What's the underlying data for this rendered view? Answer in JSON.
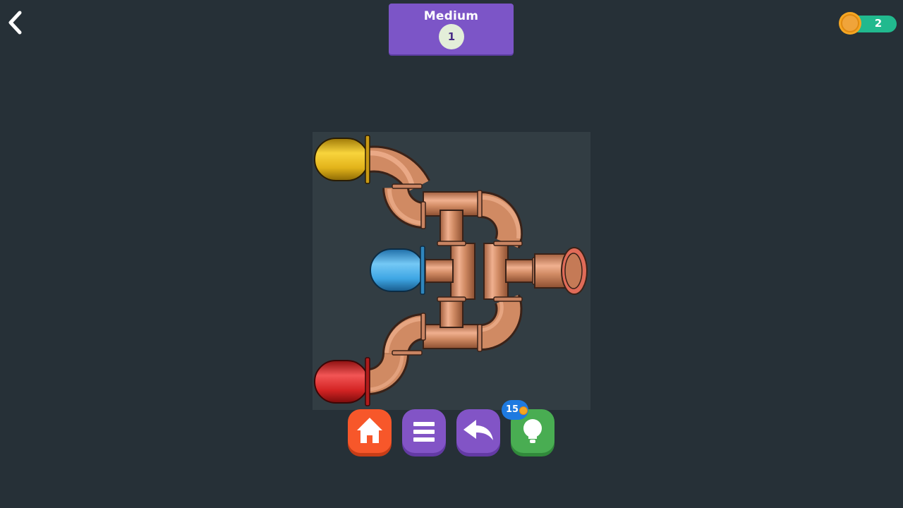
{
  "header": {
    "back_icon": "chevron-left-icon",
    "difficulty": "Medium",
    "level_number": "1",
    "coins": "2"
  },
  "colors": {
    "background": "#263037",
    "board_cell": "#323d43",
    "level_card": "#7c55c7",
    "coin_pill": "#21b98e",
    "copper": "#cd8a64",
    "yellow_source": "#e9bd1b",
    "blue_source": "#3ea6e4",
    "red_source": "#d42424",
    "home_button": "#f7572a",
    "menu_button": "#8254c6",
    "undo_button": "#8254c6",
    "hint_button": "#49ad52"
  },
  "board": {
    "rows": 5,
    "cols": 5,
    "sources": [
      {
        "color": "yellow",
        "row": 1,
        "col": 1
      },
      {
        "color": "blue",
        "row": 3,
        "col": 2
      },
      {
        "color": "red",
        "row": 5,
        "col": 1
      }
    ],
    "outlet": {
      "row": 3,
      "col": 5
    },
    "tiles": [
      {
        "row": 1,
        "col": 2,
        "type": "elbow"
      },
      {
        "row": 2,
        "col": 2,
        "type": "elbow"
      },
      {
        "row": 2,
        "col": 3,
        "type": "tee"
      },
      {
        "row": 2,
        "col": 4,
        "type": "elbow"
      },
      {
        "row": 3,
        "col": 3,
        "type": "tee"
      },
      {
        "row": 3,
        "col": 4,
        "type": "tee"
      },
      {
        "row": 4,
        "col": 2,
        "type": "elbow"
      },
      {
        "row": 4,
        "col": 3,
        "type": "tee"
      },
      {
        "row": 4,
        "col": 4,
        "type": "elbow"
      },
      {
        "row": 5,
        "col": 2,
        "type": "elbow"
      }
    ]
  },
  "toolbar": {
    "home_icon": "home-icon",
    "menu_icon": "list-icon",
    "undo_icon": "undo-icon",
    "hint_icon": "lightbulb-icon",
    "hint_cost": "15"
  }
}
